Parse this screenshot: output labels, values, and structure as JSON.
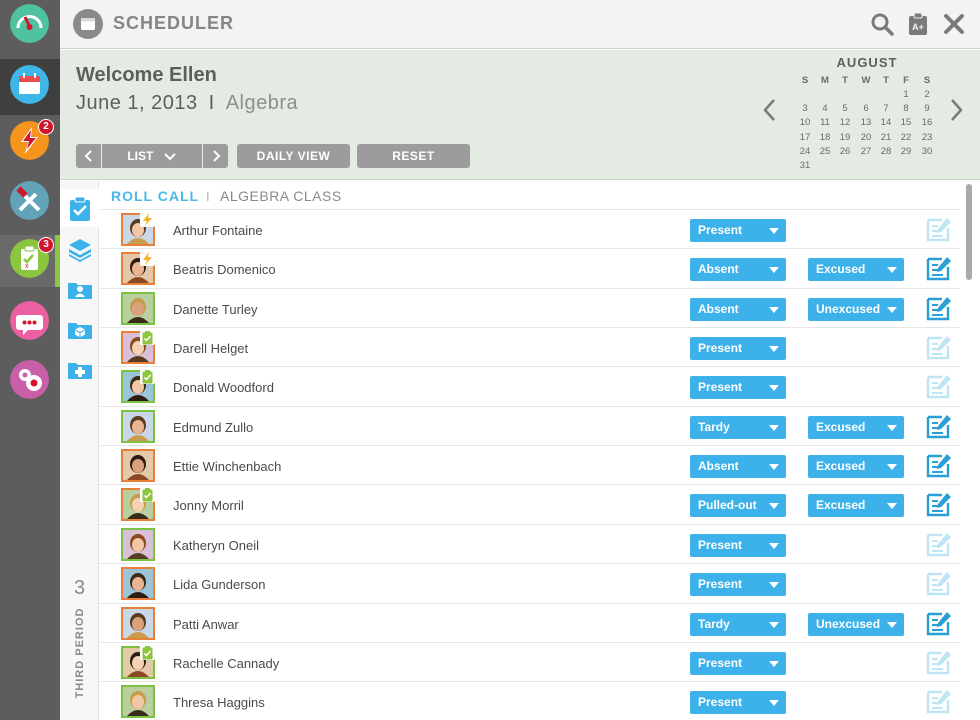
{
  "app": {
    "title": "SCHEDULER"
  },
  "sidebar": {
    "items": [
      {
        "name": "dashboard-gauge-icon",
        "color": "#4fc3a1"
      },
      {
        "name": "calendar-icon",
        "color": "#3fb6e8",
        "active": true
      },
      {
        "name": "lightning-alert-icon",
        "color": "#f7941d",
        "badge": "2"
      },
      {
        "name": "tools-icon",
        "color": "#61a4b8"
      },
      {
        "name": "clipboard-grade-icon",
        "color": "#8cc63f",
        "badge": "3"
      },
      {
        "name": "chat-bubble-icon",
        "color": "#ec5fa3"
      },
      {
        "name": "settings-gears-icon",
        "color": "#c85fa8"
      }
    ]
  },
  "header": {
    "welcome": "Welcome Ellen",
    "date": "June 1, 2013",
    "separator": "I",
    "subject": "Algebra",
    "controls": {
      "list_label": "LIST",
      "daily_view": "DAILY VIEW",
      "reset": "RESET"
    }
  },
  "calendar": {
    "month": "AUGUST",
    "weekdays": [
      "S",
      "M",
      "T",
      "W",
      "T",
      "F",
      "S"
    ],
    "weeks": [
      [
        "",
        "",
        "",
        "",
        "",
        "1",
        "2"
      ],
      [
        "3",
        "4",
        "5",
        "6",
        "7",
        "8",
        "9"
      ],
      [
        "10",
        "11",
        "12",
        "13",
        "14",
        "15",
        "16"
      ],
      [
        "17",
        "18",
        "19",
        "20",
        "21",
        "22",
        "23"
      ],
      [
        "24",
        "25",
        "26",
        "27",
        "28",
        "29",
        "30"
      ],
      [
        "31",
        "",
        "",
        "",
        "",
        "",
        ""
      ]
    ]
  },
  "side_panel": {
    "period_number": "3",
    "period_label": "THIRD PERIOD"
  },
  "roll_call": {
    "title": "ROLL CALL",
    "separator": "I",
    "class_name": "ALGEBRA CLASS",
    "students": [
      {
        "name": "Arthur Fontaine",
        "status": "Present",
        "reason": "",
        "border": "orange",
        "flag": "lightning"
      },
      {
        "name": "Beatris Domenico",
        "status": "Absent",
        "reason": "Excused",
        "border": "orange",
        "flag": "lightning"
      },
      {
        "name": "Danette Turley",
        "status": "Absent",
        "reason": "Unexcused",
        "border": "green",
        "flag": ""
      },
      {
        "name": "Darell Helget",
        "status": "Present",
        "reason": "",
        "border": "orange",
        "flag": "clipboard"
      },
      {
        "name": "Donald Woodford",
        "status": "Present",
        "reason": "",
        "border": "green",
        "flag": "clipboard"
      },
      {
        "name": "Edmund Zullo",
        "status": "Tardy",
        "reason": "Excused",
        "border": "green",
        "flag": ""
      },
      {
        "name": "Ettie Winchenbach",
        "status": "Absent",
        "reason": "Excused",
        "border": "orange",
        "flag": ""
      },
      {
        "name": "Jonny Morril",
        "status": "Pulled-out",
        "reason": "Excused",
        "border": "orange",
        "flag": "clipboard"
      },
      {
        "name": "Katheryn Oneil",
        "status": "Present",
        "reason": "",
        "border": "green",
        "flag": ""
      },
      {
        "name": "Lida Gunderson",
        "status": "Present",
        "reason": "",
        "border": "orange",
        "flag": ""
      },
      {
        "name": "Patti Anwar",
        "status": "Tardy",
        "reason": "Unexcused",
        "border": "orange",
        "flag": ""
      },
      {
        "name": "Rachelle Cannady",
        "status": "Present",
        "reason": "",
        "border": "green",
        "flag": "clipboard"
      },
      {
        "name": "Thresa Haggins",
        "status": "Present",
        "reason": "",
        "border": "green",
        "flag": ""
      }
    ]
  },
  "colors": {
    "accent_blue": "#3db2ea",
    "orange": "#e8803a",
    "green": "#7cc242",
    "note_active": "#2a9fd6",
    "note_inactive": "#bfe5f5"
  }
}
